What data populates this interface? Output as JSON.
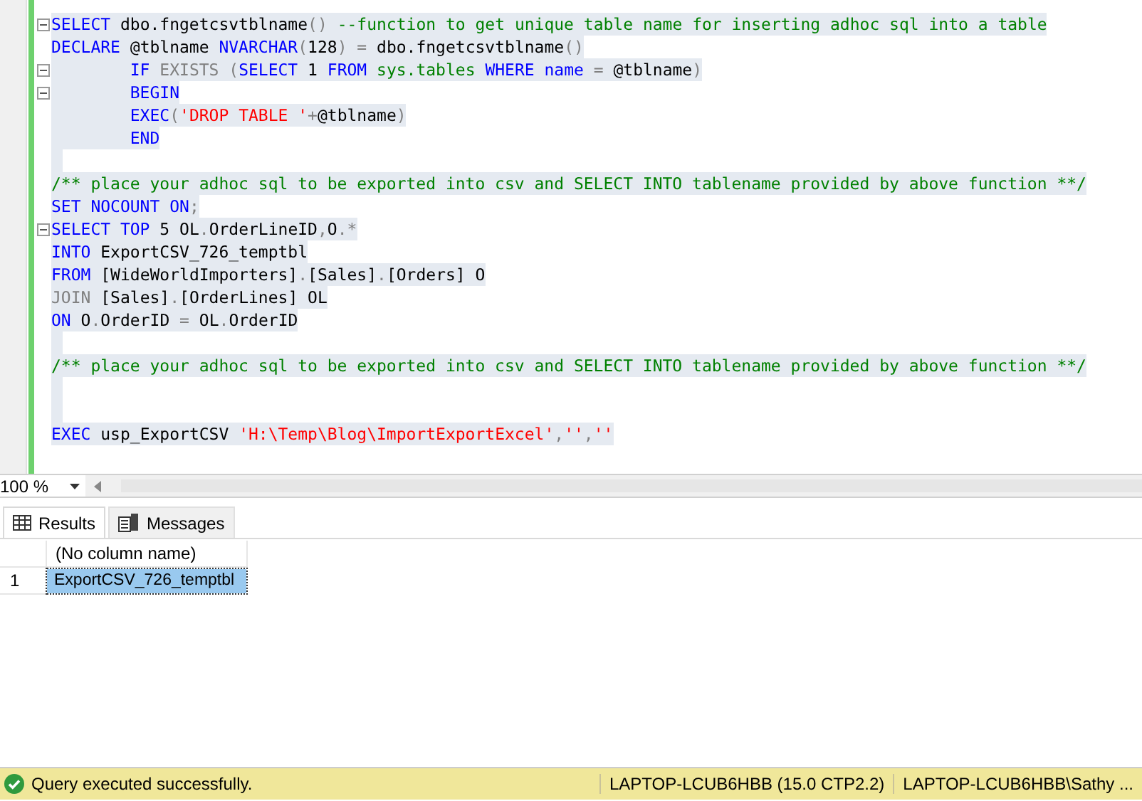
{
  "editor": {
    "lines": [
      {
        "foldable": true,
        "tokens": [
          {
            "kind": "keyword",
            "text": "SELECT"
          },
          {
            "kind": "plain",
            "text": " dbo.fngetcsvtblname"
          },
          {
            "kind": "operator",
            "text": "()"
          },
          {
            "kind": "comment",
            "text": " --function to get unique table name for inserting adhoc sql into a table"
          }
        ]
      },
      {
        "foldable": false,
        "tokens": [
          {
            "kind": "keyword",
            "text": "DECLARE"
          },
          {
            "kind": "plain",
            "text": " @tblname"
          },
          {
            "kind": "keyword",
            "text": " NVARCHAR"
          },
          {
            "kind": "operator",
            "text": "("
          },
          {
            "kind": "plain",
            "text": "128"
          },
          {
            "kind": "operator",
            "text": ") ="
          },
          {
            "kind": "plain",
            "text": " dbo.fngetcsvtblname"
          },
          {
            "kind": "operator",
            "text": "()"
          }
        ]
      },
      {
        "foldable": true,
        "tokens": [
          {
            "kind": "keyword",
            "text": "        IF"
          },
          {
            "kind": "operator",
            "text": " EXISTS ("
          },
          {
            "kind": "keyword",
            "text": "SELECT"
          },
          {
            "kind": "plain",
            "text": " 1"
          },
          {
            "kind": "keyword",
            "text": " FROM"
          },
          {
            "kind": "system",
            "text": " sys.tables"
          },
          {
            "kind": "keyword",
            "text": " WHERE name"
          },
          {
            "kind": "operator",
            "text": " ="
          },
          {
            "kind": "plain",
            "text": " @tblname"
          },
          {
            "kind": "operator",
            "text": ")"
          }
        ]
      },
      {
        "foldable": true,
        "tokens": [
          {
            "kind": "keyword",
            "text": "        BEGIN"
          }
        ]
      },
      {
        "foldable": false,
        "tokens": [
          {
            "kind": "keyword",
            "text": "        EXEC"
          },
          {
            "kind": "operator",
            "text": "("
          },
          {
            "kind": "string",
            "text": "'DROP TABLE '"
          },
          {
            "kind": "operator",
            "text": "+"
          },
          {
            "kind": "plain",
            "text": "@tblname"
          },
          {
            "kind": "operator",
            "text": ")"
          }
        ]
      },
      {
        "foldable": false,
        "tokens": [
          {
            "kind": "keyword",
            "text": "        END"
          }
        ]
      },
      {
        "foldable": false
      },
      {
        "foldable": false,
        "tokens": [
          {
            "kind": "comment",
            "text": "/** place your adhoc sql to be exported into csv and SELECT INTO tablename provided by above function **/"
          }
        ]
      },
      {
        "foldable": false,
        "tokens": [
          {
            "kind": "keyword",
            "text": "SET NOCOUNT ON"
          },
          {
            "kind": "operator",
            "text": ";"
          }
        ]
      },
      {
        "foldable": true,
        "tokens": [
          {
            "kind": "keyword",
            "text": "SELECT TOP"
          },
          {
            "kind": "plain",
            "text": " 5 OL"
          },
          {
            "kind": "operator",
            "text": "."
          },
          {
            "kind": "plain",
            "text": "OrderLineID"
          },
          {
            "kind": "operator",
            "text": ","
          },
          {
            "kind": "plain",
            "text": "O"
          },
          {
            "kind": "operator",
            "text": ".*"
          }
        ]
      },
      {
        "foldable": false,
        "tokens": [
          {
            "kind": "keyword",
            "text": "INTO"
          },
          {
            "kind": "plain",
            "text": " ExportCSV_726_temptbl"
          }
        ]
      },
      {
        "foldable": false,
        "tokens": [
          {
            "kind": "keyword",
            "text": "FROM"
          },
          {
            "kind": "plain",
            "text": " [WideWorldImporters]"
          },
          {
            "kind": "operator",
            "text": "."
          },
          {
            "kind": "plain",
            "text": "[Sales]"
          },
          {
            "kind": "operator",
            "text": "."
          },
          {
            "kind": "plain",
            "text": "[Orders] O"
          }
        ]
      },
      {
        "foldable": false,
        "tokens": [
          {
            "kind": "operator",
            "text": "JOIN"
          },
          {
            "kind": "plain",
            "text": " [Sales]"
          },
          {
            "kind": "operator",
            "text": "."
          },
          {
            "kind": "plain",
            "text": "[OrderLines] OL"
          }
        ]
      },
      {
        "foldable": false,
        "tokens": [
          {
            "kind": "keyword",
            "text": "ON"
          },
          {
            "kind": "plain",
            "text": " O"
          },
          {
            "kind": "operator",
            "text": "."
          },
          {
            "kind": "plain",
            "text": "OrderID"
          },
          {
            "kind": "operator",
            "text": " ="
          },
          {
            "kind": "plain",
            "text": " OL"
          },
          {
            "kind": "operator",
            "text": "."
          },
          {
            "kind": "plain",
            "text": "OrderID"
          }
        ]
      },
      {
        "foldable": false
      },
      {
        "foldable": false,
        "tokens": [
          {
            "kind": "comment",
            "text": "/** place your adhoc sql to be exported into csv and SELECT INTO tablename provided by above function **/"
          }
        ]
      },
      {
        "foldable": false
      },
      {
        "foldable": false
      },
      {
        "foldable": false,
        "tokens": [
          {
            "kind": "keyword",
            "text": "EXEC"
          },
          {
            "kind": "plain",
            "text": " usp_ExportCSV"
          },
          {
            "kind": "string",
            "text": " 'H:\\Temp\\Blog\\ImportExportExcel'"
          },
          {
            "kind": "operator",
            "text": ","
          },
          {
            "kind": "string",
            "text": "''"
          },
          {
            "kind": "operator",
            "text": ","
          },
          {
            "kind": "string",
            "text": "''"
          }
        ]
      }
    ]
  },
  "zoom": "100 %",
  "tabs": [
    {
      "label": "Results",
      "kind": "grid",
      "selected": true
    },
    {
      "label": "Messages",
      "kind": "messages",
      "selected": false
    }
  ],
  "results": {
    "columns": [
      "(No column name)"
    ],
    "rows": [
      {
        "number": "1",
        "cells": [
          "ExportCSV_726_temptbl"
        ],
        "selected": true
      }
    ]
  },
  "status_bar": {
    "message": "Query executed successfully.",
    "server": "LAPTOP-LCUB6HBB (15.0 CTP2.2)",
    "user": "LAPTOP-LCUB6HBB\\Sathy ..."
  }
}
